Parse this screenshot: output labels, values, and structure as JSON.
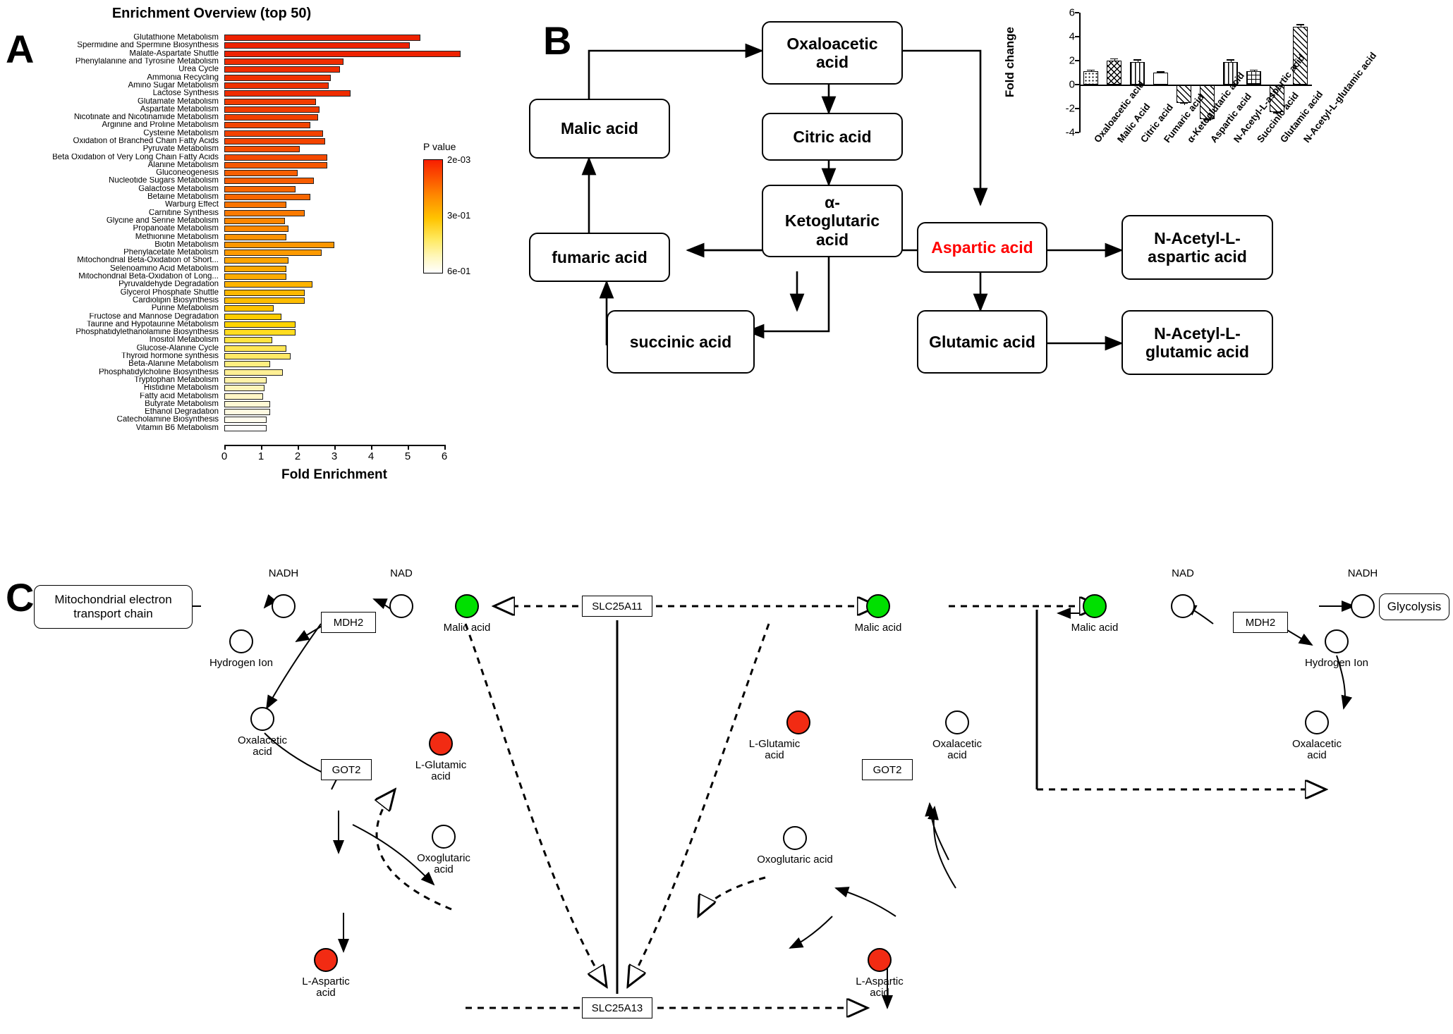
{
  "panels": {
    "a": "A",
    "b": "B",
    "c": "C"
  },
  "panelA": {
    "title": "Enrichment Overview (top 50)",
    "xlabel": "Fold Enrichment",
    "legend": {
      "title": "P value",
      "ticks": [
        "2e-03",
        "3e-01",
        "6e-01"
      ]
    },
    "axis_ticks": [
      "0",
      "1",
      "2",
      "3",
      "4",
      "5",
      "6"
    ]
  },
  "chart_data": {
    "type": "bar",
    "title": "Enrichment Overview (top 50)",
    "xlabel": "Fold Enrichment",
    "ylabel": "",
    "xlim": [
      0,
      6.6
    ],
    "orientation": "horizontal",
    "colorbar": {
      "label": "P value",
      "ticks": [
        "2e-03",
        "3e-01",
        "6e-01"
      ],
      "high_color": "#f81f00",
      "low_color": "#ffffff"
    },
    "categories": [
      "Glutathione Metabolism",
      "Spermidine and Spermine Biosynthesis",
      "Malate-Aspartate Shuttle",
      "Phenylalanine and Tyrosine Metabolism",
      "Urea Cycle",
      "Ammonia Recycling",
      "Amino Sugar Metabolism",
      "Lactose Synthesis",
      "Glutamate Metabolism",
      "Aspartate Metabolism",
      "Nicotinate and Nicotinamide Metabolism",
      "Arginine and Proline Metabolism",
      "Cysteine Metabolism",
      "Oxidation of Branched Chain Fatty Acids",
      "Pyruvate Metabolism",
      "Beta Oxidation of Very Long Chain Fatty Acids",
      "Alanine Metabolism",
      "Gluconeogenesis",
      "Nucleotide Sugars Metabolism",
      "Galactose Metabolism",
      "Betaine Metabolism",
      "Warburg Effect",
      "Carnitine Synthesis",
      "Glycine and Serine Metabolism",
      "Propanoate Metabolism",
      "Methionine Metabolism",
      "Biotin Metabolism",
      "Phenylacetate Metabolism",
      "Mitochondrial Beta-Oxidation of Short...",
      "Selenoamino Acid Metabolism",
      "Mitochondrial Beta-Oxidation of Long...",
      "Pyruvaldehyde Degradation",
      "Glycerol Phosphate Shuttle",
      "Cardiolipin Biosynthesis",
      "Purine Metabolism",
      "Fructose and Mannose Degradation",
      "Taurine and Hypotaurine Metabolism",
      "Phosphatidylethanolamine Biosynthesis",
      "Inositol Metabolism",
      "Glucose-Alanine Cycle",
      "Thyroid hormone synthesis",
      "Beta-Alanine Metabolism",
      "Phosphatidylcholine Biosynthesis",
      "Tryptophan Metabolism",
      "Histidine Metabolism",
      "Fatty acid Metabolism",
      "Butyrate Metabolism",
      "Ethanol Degradation",
      "Catecholamine Biosynthesis",
      "Vitamin B6 Metabolism"
    ],
    "values": [
      5.35,
      5.05,
      6.45,
      3.25,
      3.15,
      2.9,
      2.85,
      3.45,
      2.5,
      2.6,
      2.55,
      2.35,
      2.7,
      2.75,
      2.05,
      2.8,
      2.8,
      2.0,
      2.45,
      1.95,
      2.35,
      1.7,
      2.2,
      1.65,
      1.75,
      1.7,
      3.0,
      2.65,
      1.75,
      1.7,
      1.7,
      2.4,
      2.2,
      2.2,
      1.35,
      1.55,
      1.95,
      1.95,
      1.3,
      1.7,
      1.8,
      1.25,
      1.6,
      1.15,
      1.1,
      1.05,
      1.25,
      1.25,
      1.15,
      1.15
    ],
    "bar_colors": [
      "#ee2200",
      "#ee2200",
      "#ee2200",
      "#f02d00",
      "#f02d00",
      "#f03000",
      "#f03200",
      "#f02d00",
      "#f23c00",
      "#f23c00",
      "#f23f00",
      "#f34400",
      "#f44200",
      "#f44400",
      "#f54d00",
      "#f54a00",
      "#f75700",
      "#f85f00",
      "#f85d00",
      "#f96600",
      "#f96600",
      "#fa7400",
      "#fb7a00",
      "#fc8500",
      "#fc8800",
      "#fd9200",
      "#fd9600",
      "#fd9a00",
      "#fda400",
      "#fda800",
      "#fdac00",
      "#feb400",
      "#feb800",
      "#febd00",
      "#fec400",
      "#fecc00",
      "#fed400",
      "#ffdd20",
      "#ffe340",
      "#ffe755",
      "#ffea66",
      "#ffee80",
      "#fff095",
      "#fff2a8",
      "#fff4b8",
      "#fff6c6",
      "#fff8d4",
      "#fffae0",
      "#fffcee",
      "#fefefe"
    ]
  },
  "panelB": {
    "nodes": [
      {
        "id": "oxaloacetic",
        "label": "Oxaloacetic\nacid"
      },
      {
        "id": "malic",
        "label": "Malic acid"
      },
      {
        "id": "citric",
        "label": "Citric acid"
      },
      {
        "id": "ketoglutaric",
        "label": "α-\nKetoglutaric\nacid"
      },
      {
        "id": "fumaric",
        "label": "fumaric acid"
      },
      {
        "id": "aspartic",
        "label": "Aspartic acid",
        "highlight": true
      },
      {
        "id": "nacetyl-aspartic",
        "label": "N-Acetyl-L-\naspartic acid"
      },
      {
        "id": "succinic",
        "label": "succinic acid"
      },
      {
        "id": "glutamic",
        "label": "Glutamic acid"
      },
      {
        "id": "nacetyl-glutamic",
        "label": "N-Acetyl-L-\nglutamic acid"
      }
    ],
    "inset": {
      "ylabel": "Fold change",
      "yticks": [
        "6",
        "4",
        "2",
        "0",
        "-2",
        "-4"
      ],
      "ylim": [
        -4,
        6
      ]
    }
  },
  "inset_chart_data": {
    "type": "bar",
    "title": "",
    "ylabel": "Fold change",
    "xlabel": "",
    "ylim": [
      -4,
      6
    ],
    "yticks": [
      -4,
      -2,
      0,
      2,
      4,
      6
    ],
    "categories": [
      "Oxaloacetic acid",
      "Malic Acid",
      "Citric acid",
      "Fumaric acid",
      "α-Ketoglutaric acid",
      "Aspartic acid",
      "N-Acetyl-L-aspartic acid",
      "Succinic acid",
      "Glutamic acid",
      "N-Acetyl-L-glutamic acid"
    ],
    "values": [
      1.1,
      2.0,
      1.9,
      1.0,
      -1.5,
      -2.9,
      1.9,
      1.1,
      -2.3,
      4.8
    ],
    "errors": [
      0.15,
      0.2,
      0.2,
      0.12,
      0.2,
      0.3,
      0.2,
      0.15,
      0.25,
      0.25
    ]
  },
  "panelC": {
    "labels": {
      "mito_chain": "Mitochondrial electron\ntransport chain",
      "glycolysis": "Glycolysis",
      "mdh2": "MDH2",
      "got2": "GOT2",
      "slc25a11": "SLC25A11",
      "slc25a13": "SLC25A13",
      "nadh": "NADH",
      "nad": "NAD",
      "hydrogen_ion": "Hydrogen Ion",
      "malic_acid": "Malic acid",
      "oxalacetic_acid": "Oxalacetic\nacid",
      "l_glutamic_acid": "L-Glutamic\nacid",
      "oxoglutaric_acid": "Oxoglutaric\nacid",
      "oxoglutaric_acid_full": "Oxoglutaric acid",
      "l_aspartic_acid": "L-Aspartic\nacid"
    },
    "colors": {
      "green": "#00e000",
      "red": "#f22b13",
      "white": "#ffffff"
    }
  }
}
